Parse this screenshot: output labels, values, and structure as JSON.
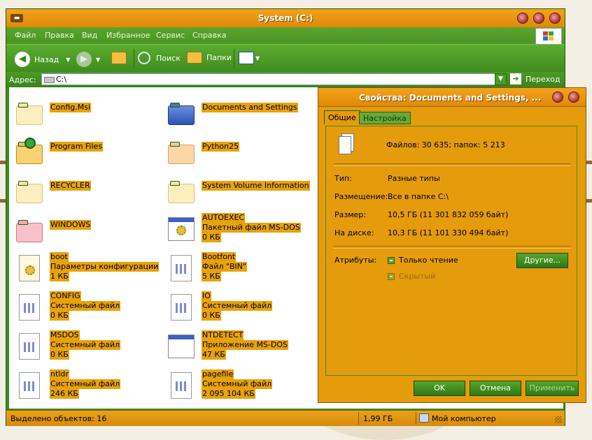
{
  "window": {
    "title": "System (C:)"
  },
  "menu": {
    "items": [
      "Файл",
      "Правка",
      "Вид",
      "Избранное",
      "Сервис",
      "Справка"
    ]
  },
  "toolbar": {
    "back_label": "Назад",
    "search_label": "Поиск",
    "folders_label": "Папки"
  },
  "address": {
    "label": "Адрес:",
    "value": "C:\\",
    "go_label": "Переход"
  },
  "files": [
    {
      "name": "Config.Msi",
      "type": "",
      "size": "",
      "icon": "folder-icon"
    },
    {
      "name": "Documents and Settings",
      "type": "",
      "size": "",
      "icon": "folder-blue-icon"
    },
    {
      "name": "Program Files",
      "type": "",
      "size": "",
      "icon": "folder-program-icon"
    },
    {
      "name": "Python25",
      "type": "",
      "size": "",
      "icon": "folder-icon"
    },
    {
      "name": "RECYCLER",
      "type": "",
      "size": "",
      "icon": "folder-icon"
    },
    {
      "name": "System Volume Information",
      "type": "",
      "size": "",
      "icon": "folder-icon"
    },
    {
      "name": "WINDOWS",
      "type": "",
      "size": "",
      "icon": "folder-red-icon"
    },
    {
      "name": "AUTOEXEC",
      "type": "Пакетный файл MS-DOS",
      "size": "0 КБ",
      "icon": "batch-file-icon"
    },
    {
      "name": "boot",
      "type": "Параметры конфигурации",
      "size": "1 КБ",
      "icon": "config-file-icon"
    },
    {
      "name": "Bootfont",
      "type": "Файл \"BIN\"",
      "size": "5 КБ",
      "icon": "system-file-icon"
    },
    {
      "name": "CONFIG",
      "type": "Системный файл",
      "size": "0 КБ",
      "icon": "system-file-icon"
    },
    {
      "name": "IO",
      "type": "Системный файл",
      "size": "0 КБ",
      "icon": "system-file-icon"
    },
    {
      "name": "MSDOS",
      "type": "Системный файл",
      "size": "0 КБ",
      "icon": "system-file-icon"
    },
    {
      "name": "NTDETECT",
      "type": "Приложение MS-DOS",
      "size": "47 КБ",
      "icon": "msdos-app-icon"
    },
    {
      "name": "ntldr",
      "type": "Системный файл",
      "size": "246 КБ",
      "icon": "system-file-icon"
    },
    {
      "name": "pagefile",
      "type": "Системный файл",
      "size": "2 095 104 КБ",
      "icon": "system-file-icon"
    }
  ],
  "status": {
    "selected": "Выделено объектов: 16",
    "size": "1,99 ГБ",
    "location": "Мой компьютер"
  },
  "dialog": {
    "title": "Свойства: Documents and Settings, ...",
    "tabs": [
      "Общие",
      "Настройка"
    ],
    "summary": "Файлов: 30 635; папок: 5 213",
    "type_label": "Тип:",
    "type_value": "Разные типы",
    "location_label": "Размещение:",
    "location_value": "Все в папке C:\\",
    "size_label": "Размер:",
    "size_value": "10,5 ГБ (11 301 832 059 байт)",
    "disk_label": "На диске:",
    "disk_value": "10,3 ГБ (11 101 330 494 байт)",
    "attributes_label": "Атрибуты:",
    "readonly_label": "Только чтение",
    "hidden_label": "Скрытый",
    "other_button": "Другие...",
    "ok": "OK",
    "cancel": "Отмена",
    "apply": "Применить"
  }
}
